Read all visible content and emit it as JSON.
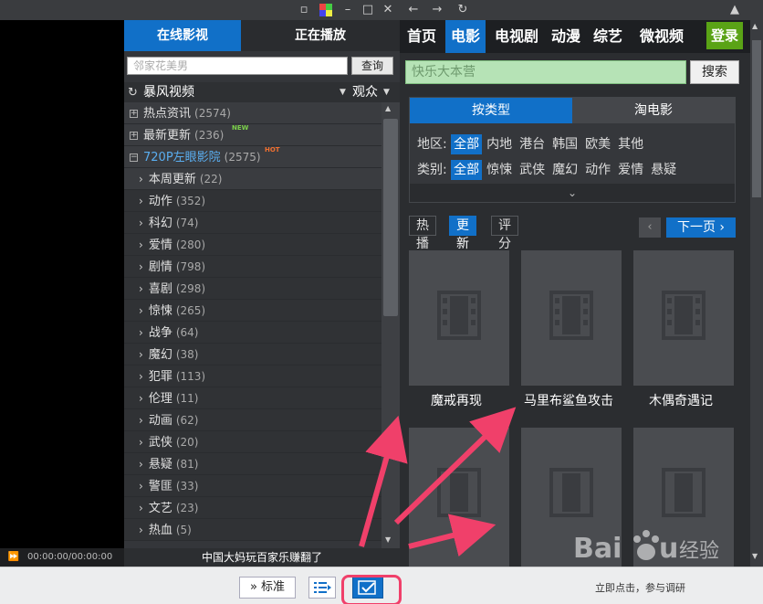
{
  "player": {
    "time": "00:00:00/00:00:00",
    "ticker": "中国大妈玩百家乐赚翻了"
  },
  "playlist": {
    "tabs": [
      "在线影视",
      "正在播放"
    ],
    "search_placeholder": "邻家花美男",
    "search_button": "查询",
    "source": "暴风视频",
    "audience": "观众",
    "top_items": [
      {
        "label": "热点资讯",
        "count": "(2574)",
        "badge": ""
      },
      {
        "label": "最新更新",
        "count": "(236)",
        "badge": "NEW"
      },
      {
        "label": "720P左眼影院",
        "count": "(2575)",
        "badge": "HOT"
      }
    ],
    "sub_items": [
      {
        "label": "本周更新",
        "count": "(22)"
      },
      {
        "label": "动作",
        "count": "(352)"
      },
      {
        "label": "科幻",
        "count": "(74)"
      },
      {
        "label": "爱情",
        "count": "(280)"
      },
      {
        "label": "剧情",
        "count": "(798)"
      },
      {
        "label": "喜剧",
        "count": "(298)"
      },
      {
        "label": "惊悚",
        "count": "(265)"
      },
      {
        "label": "战争",
        "count": "(64)"
      },
      {
        "label": "魔幻",
        "count": "(38)"
      },
      {
        "label": "犯罪",
        "count": "(113)"
      },
      {
        "label": "伦理",
        "count": "(11)"
      },
      {
        "label": "动画",
        "count": "(62)"
      },
      {
        "label": "武侠",
        "count": "(20)"
      },
      {
        "label": "悬疑",
        "count": "(81)"
      },
      {
        "label": "警匪",
        "count": "(33)"
      },
      {
        "label": "文艺",
        "count": "(23)"
      },
      {
        "label": "热血",
        "count": "(5)"
      }
    ]
  },
  "browser": {
    "nav": [
      "首页",
      "电影",
      "电视剧",
      "动漫",
      "综艺",
      "微视频"
    ],
    "login": "登录",
    "search_placeholder": "快乐大本营",
    "search_button": "搜索",
    "filter_tabs": [
      "按类型",
      "淘电影"
    ],
    "region_label": "地区:",
    "regions": [
      "全部",
      "内地",
      "港台",
      "韩国",
      "欧美",
      "其他"
    ],
    "category_label": "类别:",
    "categories": [
      "全部",
      "惊悚",
      "武侠",
      "魔幻",
      "动作",
      "爱情",
      "悬疑"
    ],
    "sort_tabs": [
      "热播",
      "更新",
      "评分"
    ],
    "next_page": "下一页 ›",
    "prev_page": "‹",
    "movies": [
      "魔戒再现",
      "马里布鲨鱼攻击",
      "木偶奇遇记"
    ]
  },
  "toolbar": {
    "standard": "标准",
    "hint": "立即点击，参与调研"
  },
  "watermark": "Baidu 经验",
  "colors": {
    "accent_blue": "#1170c8",
    "login_green": "#5aa316",
    "highlight_pink": "#f0406a"
  }
}
